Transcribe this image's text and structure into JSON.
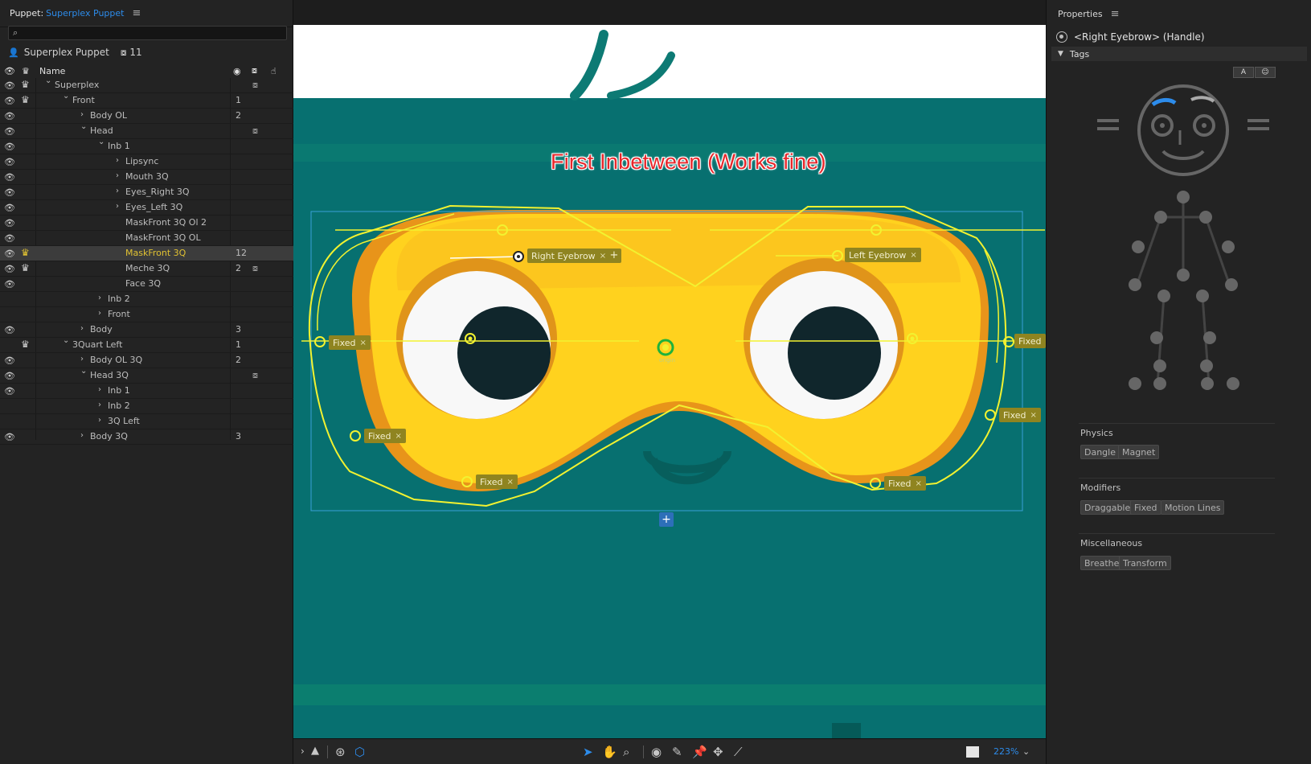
{
  "puppet_panel": {
    "title_prefix": "Puppet:",
    "title_app": "Superplex Puppet",
    "menu_glyph": "≡",
    "search_placeholder": "",
    "puppet_name": "Superplex Puppet",
    "puppet_count": "11",
    "header_name": "Name",
    "rows": [
      {
        "label": "Superplex",
        "indent": 0,
        "chevron": "v",
        "eye": true,
        "crown": true,
        "crown_yellow": false,
        "count": "",
        "cam": true,
        "selected": false
      },
      {
        "label": "Front",
        "indent": 1,
        "chevron": "v",
        "eye": true,
        "crown": true,
        "crown_yellow": false,
        "count": "1",
        "cam": false,
        "selected": false
      },
      {
        "label": "Body OL",
        "indent": 2,
        "chevron": ">",
        "eye": true,
        "crown": false,
        "crown_yellow": false,
        "count": "2",
        "cam": false,
        "selected": false
      },
      {
        "label": "Head",
        "indent": 2,
        "chevron": "v",
        "eye": true,
        "crown": false,
        "crown_yellow": false,
        "count": "",
        "cam": true,
        "selected": false
      },
      {
        "label": "Inb 1",
        "indent": 3,
        "chevron": "v",
        "eye": true,
        "crown": false,
        "crown_yellow": false,
        "count": "",
        "cam": false,
        "selected": false
      },
      {
        "label": "Lipsync",
        "indent": 4,
        "chevron": ">",
        "eye": true,
        "crown": false,
        "crown_yellow": false,
        "count": "",
        "cam": false,
        "selected": false
      },
      {
        "label": "Mouth 3Q",
        "indent": 4,
        "chevron": ">",
        "eye": true,
        "crown": false,
        "crown_yellow": false,
        "count": "",
        "cam": false,
        "selected": false
      },
      {
        "label": "Eyes_Right 3Q",
        "indent": 4,
        "chevron": ">",
        "eye": true,
        "crown": false,
        "crown_yellow": false,
        "count": "",
        "cam": false,
        "selected": false
      },
      {
        "label": "Eyes_Left 3Q",
        "indent": 4,
        "chevron": ">",
        "eye": true,
        "crown": false,
        "crown_yellow": false,
        "count": "",
        "cam": false,
        "selected": false
      },
      {
        "label": "MaskFront 3Q Ol 2",
        "indent": 4,
        "chevron": "",
        "eye": true,
        "crown": false,
        "crown_yellow": false,
        "count": "",
        "cam": false,
        "selected": false
      },
      {
        "label": "MaskFront 3Q OL",
        "indent": 4,
        "chevron": "",
        "eye": true,
        "crown": false,
        "crown_yellow": false,
        "count": "",
        "cam": false,
        "selected": false
      },
      {
        "label": "MaskFront 3Q",
        "indent": 4,
        "chevron": "",
        "eye": true,
        "crown": true,
        "crown_yellow": true,
        "count": "12",
        "cam": false,
        "selected": true
      },
      {
        "label": "Meche 3Q",
        "indent": 4,
        "chevron": "",
        "eye": true,
        "crown": true,
        "crown_yellow": false,
        "count": "2",
        "cam": true,
        "selected": false
      },
      {
        "label": "Face 3Q",
        "indent": 4,
        "chevron": "",
        "eye": true,
        "crown": false,
        "crown_yellow": false,
        "count": "",
        "cam": false,
        "selected": false
      },
      {
        "label": "Inb 2",
        "indent": 3,
        "chevron": ">",
        "eye": false,
        "crown": false,
        "crown_yellow": false,
        "count": "",
        "cam": false,
        "selected": false
      },
      {
        "label": "Front",
        "indent": 3,
        "chevron": ">",
        "eye": false,
        "crown": false,
        "crown_yellow": false,
        "count": "",
        "cam": false,
        "selected": false
      },
      {
        "label": "Body",
        "indent": 2,
        "chevron": ">",
        "eye": true,
        "crown": false,
        "crown_yellow": false,
        "count": "3",
        "cam": false,
        "selected": false
      },
      {
        "label": "3Quart Left",
        "indent": 1,
        "chevron": "v",
        "eye": false,
        "crown": true,
        "crown_yellow": false,
        "count": "1",
        "cam": false,
        "selected": false
      },
      {
        "label": "Body OL 3Q",
        "indent": 2,
        "chevron": ">",
        "eye": true,
        "crown": false,
        "crown_yellow": false,
        "count": "2",
        "cam": false,
        "selected": false
      },
      {
        "label": "Head 3Q",
        "indent": 2,
        "chevron": "v",
        "eye": true,
        "crown": false,
        "crown_yellow": false,
        "count": "",
        "cam": true,
        "selected": false
      },
      {
        "label": "Inb 1",
        "indent": 3,
        "chevron": ">",
        "eye": true,
        "crown": false,
        "crown_yellow": false,
        "count": "",
        "cam": false,
        "selected": false
      },
      {
        "label": "Inb 2",
        "indent": 3,
        "chevron": ">",
        "eye": false,
        "crown": false,
        "crown_yellow": false,
        "count": "",
        "cam": false,
        "selected": false
      },
      {
        "label": "3Q Left",
        "indent": 3,
        "chevron": ">",
        "eye": false,
        "crown": false,
        "crown_yellow": false,
        "count": "",
        "cam": false,
        "selected": false
      },
      {
        "label": "Body 3Q",
        "indent": 2,
        "chevron": ">",
        "eye": true,
        "crown": false,
        "crown_yellow": false,
        "count": "3",
        "cam": false,
        "selected": false
      }
    ]
  },
  "canvas": {
    "annotation": "First Inbetween (Works fine)",
    "handle_tags": {
      "right_eyebrow": "Right Eyebrow",
      "left_eyebrow": "Left Eyebrow",
      "fixed": "Fixed",
      "close_glyph": "×",
      "plus_glyph": "+"
    },
    "origin_label": "origin",
    "colors": {
      "background": "#077070",
      "mask_yellow": "#ffd21e",
      "mask_orange": "#f0a31c",
      "mesh_line": "#f2f230",
      "bounds": "#3aa0d8",
      "annotation_red": "#e8262a"
    }
  },
  "toolbar": {
    "zoom_label": "223%",
    "icons": [
      "chevron-right-icon",
      "warning-icon",
      "mesh-icon",
      "shape-icon",
      "select-arrow-icon",
      "hand-icon",
      "zoom-icon",
      "handle-tool-icon",
      "dragger-tool-icon",
      "pin-tool-icon",
      "transform-tool-icon",
      "stick-tool-icon"
    ]
  },
  "properties": {
    "title": "Properties",
    "handle_name": "<Right Eyebrow> (Handle)",
    "tags_header": "Tags",
    "mini_buttons": [
      "A",
      "☺"
    ],
    "physics_label": "Physics",
    "physics_tags": [
      "Dangle",
      "Magnet"
    ],
    "modifiers_label": "Modifiers",
    "modifiers_tags": [
      "Draggable",
      "Fixed",
      "Motion Lines"
    ],
    "misc_label": "Miscellaneous",
    "misc_tags": [
      "Breathe",
      "Transform"
    ],
    "colors": {
      "accent": "#2d8ceb",
      "selected_eyebrow": "#2d8ceb"
    }
  }
}
